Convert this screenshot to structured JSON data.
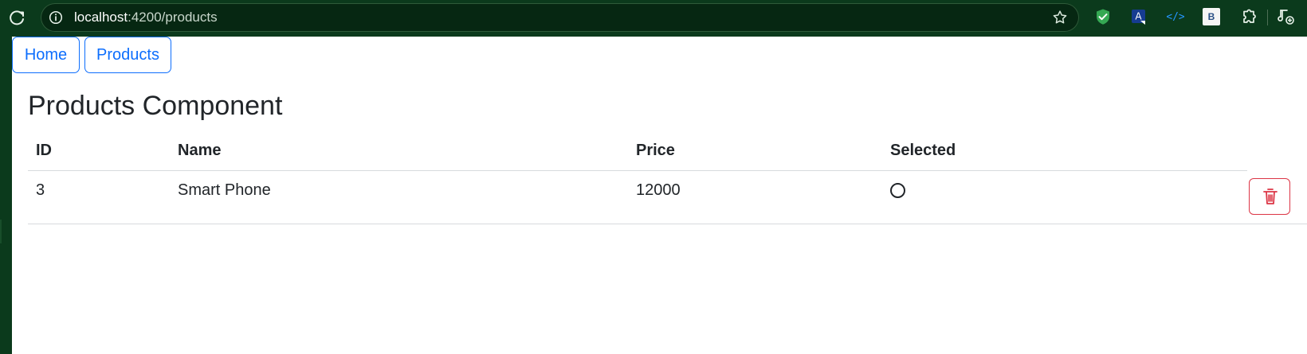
{
  "browser": {
    "url_host": "localhost",
    "url_path": ":4200/products",
    "icons": {
      "reload": "reload-icon",
      "info": "info-icon",
      "bookmark": "star-icon",
      "extensions": [
        "shield-extension-icon",
        "translate-extension-icon",
        "code-extension-icon",
        "b-extension-icon",
        "puzzle-extension-icon",
        "music-extension-icon"
      ],
      "code_extension_label": "</>",
      "b_extension_label": "B"
    }
  },
  "nav": {
    "home_label": "Home",
    "products_label": "Products"
  },
  "page": {
    "title": "Products Component"
  },
  "table": {
    "headers": {
      "id": "ID",
      "name": "Name",
      "price": "Price",
      "selected": "Selected"
    },
    "rows": [
      {
        "id": "3",
        "name": "Smart Phone",
        "price": "12000",
        "selected": false,
        "delete_icon": "trash-icon"
      }
    ]
  },
  "colors": {
    "browser_background": "#0b3a1c",
    "address_background": "#062712",
    "primary": "#0d6efd",
    "danger": "#dc3545",
    "text": "#212529",
    "divider": "#d7dadd"
  }
}
